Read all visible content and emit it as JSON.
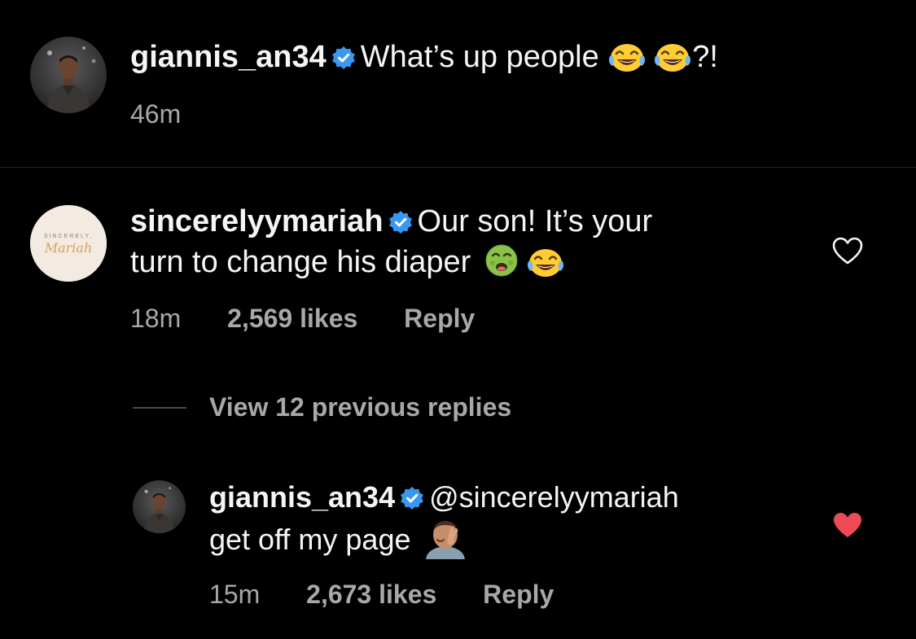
{
  "caption": {
    "username": "giannis_an34",
    "text_before_emoji": "What’s up people ",
    "emojis": [
      "face-with-tears-of-joy",
      "face-with-tears-of-joy"
    ],
    "text_after_emoji": "?!",
    "time": "46m"
  },
  "comment": {
    "username": "sincerelyymariah",
    "avatar_text_top": "SINCERELY,",
    "avatar_text_script": "Mariah",
    "line1": "Our son! It’s your",
    "line2": "turn to change his diaper",
    "emojis": [
      "nauseated-face",
      "face-with-tears-of-joy"
    ],
    "time": "18m",
    "likes": "2,569 likes",
    "reply_label": "Reply",
    "liked": false
  },
  "view_replies": "View 12 previous replies",
  "reply": {
    "username": "giannis_an34",
    "mention": "@sincerelyymariah",
    "line2": "get off my page",
    "emojis": [
      "man-facepalming"
    ],
    "time": "15m",
    "likes": "2,673 likes",
    "reply_label": "Reply",
    "liked": true
  },
  "colors": {
    "background": "#000000",
    "text": "#f5f5f5",
    "secondary": "#a8a8a8",
    "verified": "#3897f0",
    "liked_heart": "#ed4956"
  }
}
